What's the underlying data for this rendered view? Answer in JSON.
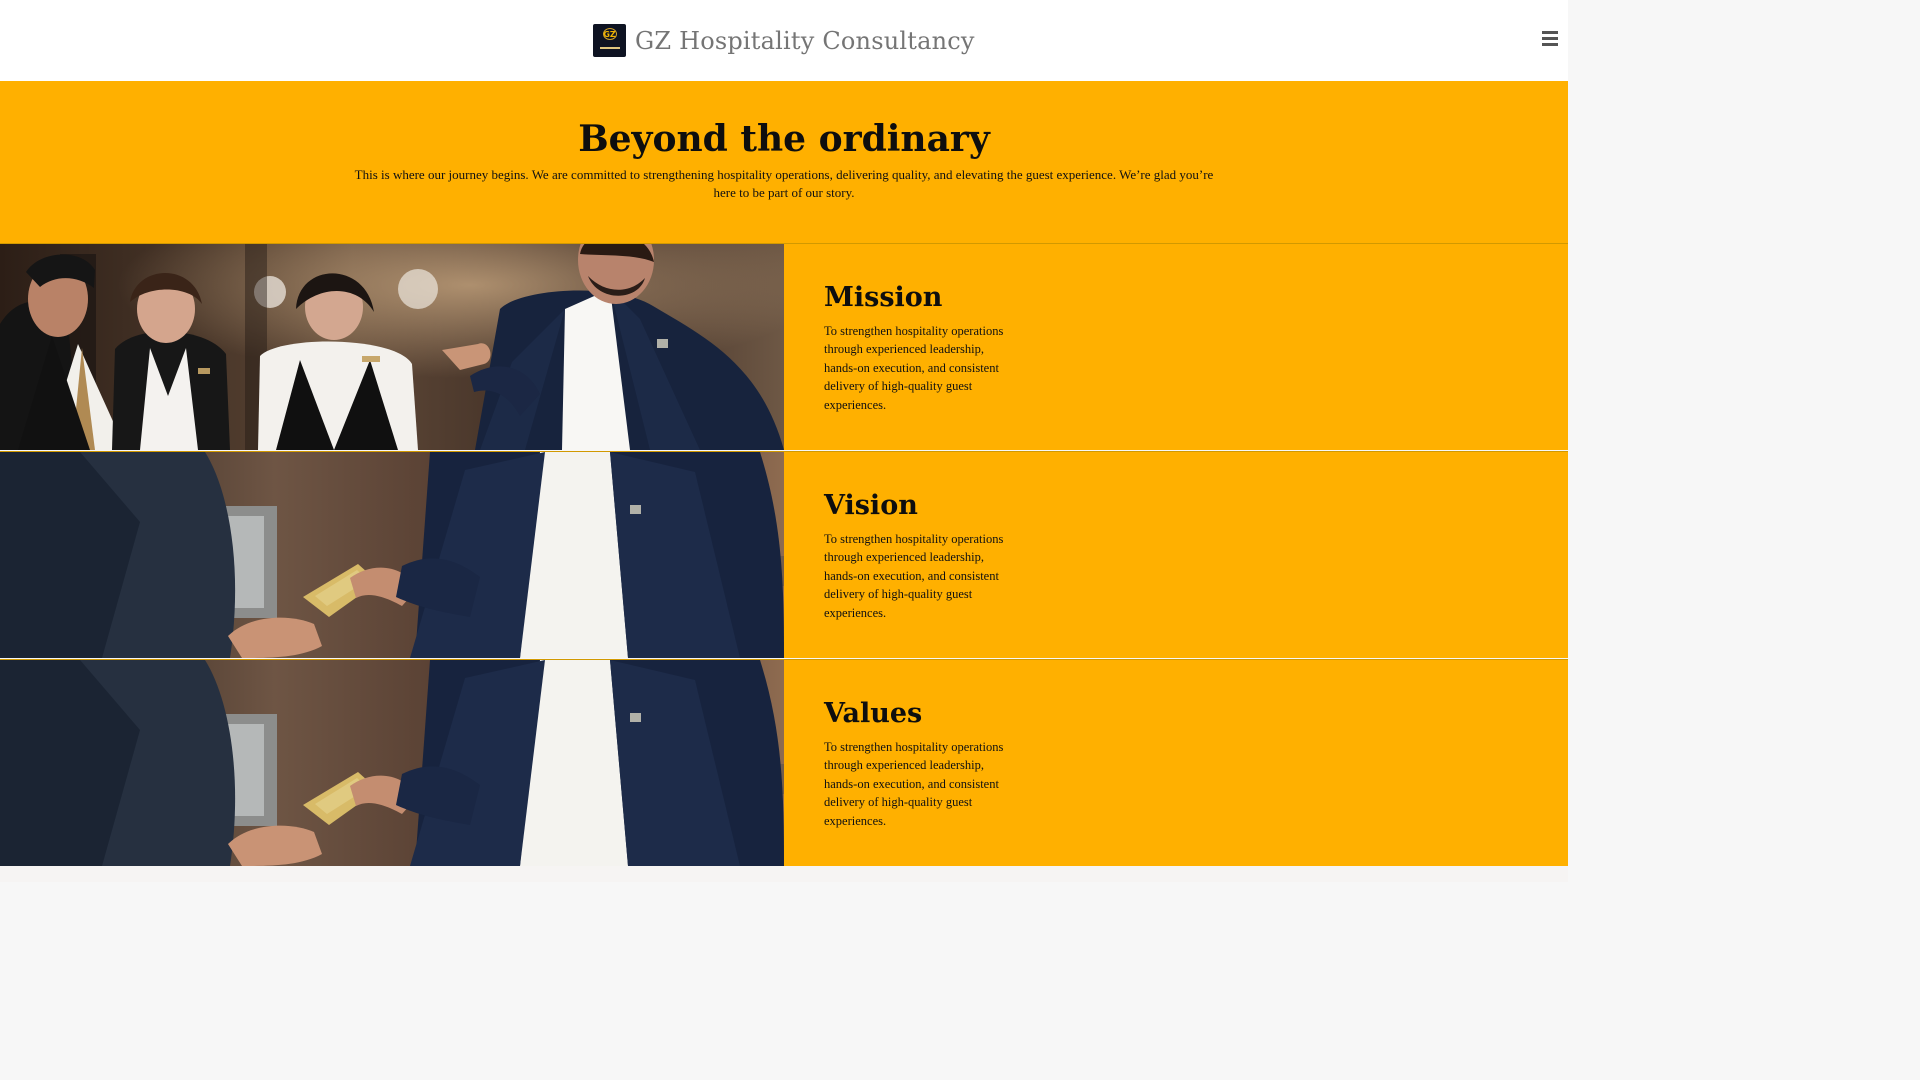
{
  "header": {
    "brand_name": "GZ Hospitality Consultancy",
    "logo_text": "GZ",
    "menu_icon": "hamburger-menu-icon"
  },
  "hero": {
    "title": "Beyond the ordinary",
    "description": "This is where our journey begins. We are committed to strengthening hospitality operations, delivering quality, and elevating the guest experience. We’re glad you’re here to be part of our story."
  },
  "sections": [
    {
      "title": "Mission",
      "text": "To strengthen hospitality operations through experienced leadership, hands-on execution, and consistent delivery of high-quality guest experiences."
    },
    {
      "title": "Vision",
      "text": "To strengthen hospitality operations through experienced leadership, hands-on execution, and consistent delivery of high-quality guest experiences."
    },
    {
      "title": "Values",
      "text": "To strengthen hospitality operations through experienced leadership, hands-on execution, and consistent delivery of high-quality guest experiences."
    }
  ],
  "colors": {
    "accent": "#ffb000",
    "header_background": "#ffffff",
    "heading_text": "#0e0e0e"
  }
}
